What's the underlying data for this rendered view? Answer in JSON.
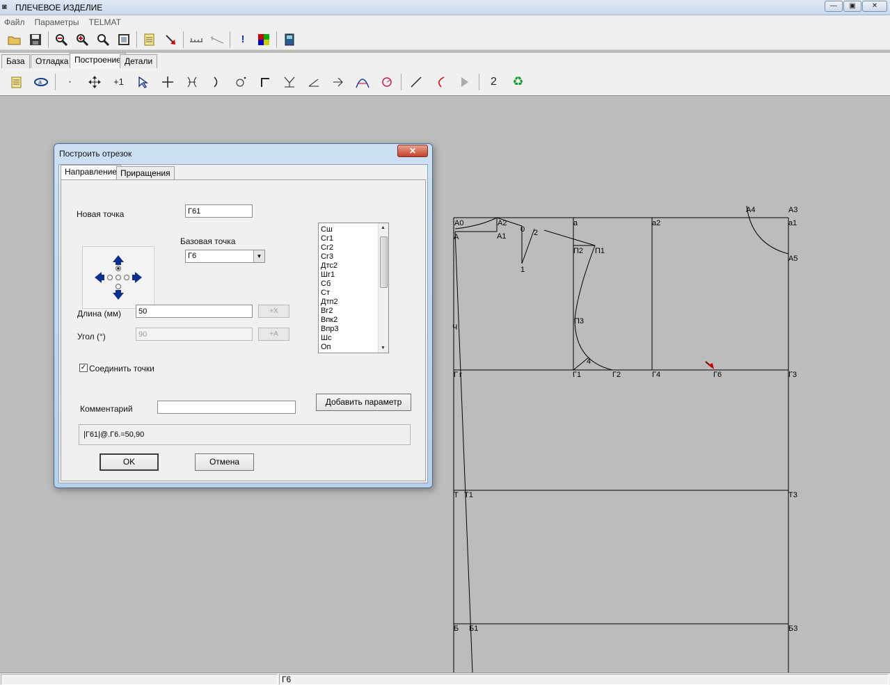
{
  "window": {
    "title": "ПЛЕЧЕВОЕ ИЗДЕЛИЕ",
    "minimize": "—",
    "maximize": "▣",
    "close": "✕"
  },
  "menu": [
    "Файл",
    "Параметры",
    "TELMAT"
  ],
  "toolbar_top": [
    "open-folder-icon",
    "save-icon",
    "zoom-out-icon",
    "zoom-in-icon",
    "zoom-icon",
    "fit-window-icon",
    "notes-icon",
    "red-arrow-icon",
    "measure-icon",
    "measure-angle-icon",
    "exclamation-icon",
    "color-palette-icon",
    "book-icon"
  ],
  "tabs": [
    "База",
    "Отладка",
    "Построение",
    "Детали"
  ],
  "active_tab": "Построение",
  "toolbar_build": {
    "counter": "2"
  },
  "dialog": {
    "title": "Построить отрезок",
    "close": "✕",
    "tabs": [
      "Направление",
      "Приращения"
    ],
    "new_point_label": "Новая точка",
    "new_point_value": "Г61",
    "base_point_label": "Базовая точка",
    "base_point_value": "Г6",
    "length_label": "Длина (мм)",
    "length_value": "50",
    "angle_label": "Угол (°)",
    "angle_value": "90",
    "plus_x": "+X",
    "plus_a": "+A",
    "connect_label": "Соединить точки",
    "connect_checked": "✓",
    "comment_label": "Комментарий",
    "comment_value": "",
    "add_param_button": "Добавить параметр",
    "formula": "|Г61|@.Г6.=50,90",
    "ok_button": "OK",
    "cancel_button": "Отмена",
    "point_list": [
      "Сш",
      "Сг1",
      "Сг2",
      "Сг3",
      "Дтс2",
      "Шг1",
      "Сб",
      "Ст",
      "Дтп2",
      "Вг2",
      "Впк2",
      "Впр3",
      "Шс",
      "Оп"
    ]
  },
  "drawing_labels": {
    "A0": "А0",
    "A": "А",
    "A2": "А2",
    "A1": "А1",
    "n0": "0",
    "n2": "2",
    "n1": "1",
    "a": "а",
    "a2": "а2",
    "A4": "А4",
    "A3": "А3",
    "a1": "а1",
    "A5": "А5",
    "P2": "П2",
    "P1": "П1",
    "P3": "П3",
    "n4": "4",
    "G": "Г",
    "g": "г",
    "G1": "Г1",
    "G2": "Г2",
    "G4": "Г4",
    "G6": "Г6",
    "G3": "Г3",
    "T": "Т",
    "T1": "Т1",
    "T3": "Т3",
    "B": "Б",
    "B1": "Б1",
    "B3": "Б3",
    "ch": "Ч"
  },
  "status": {
    "left": "",
    "right": "Г6"
  }
}
